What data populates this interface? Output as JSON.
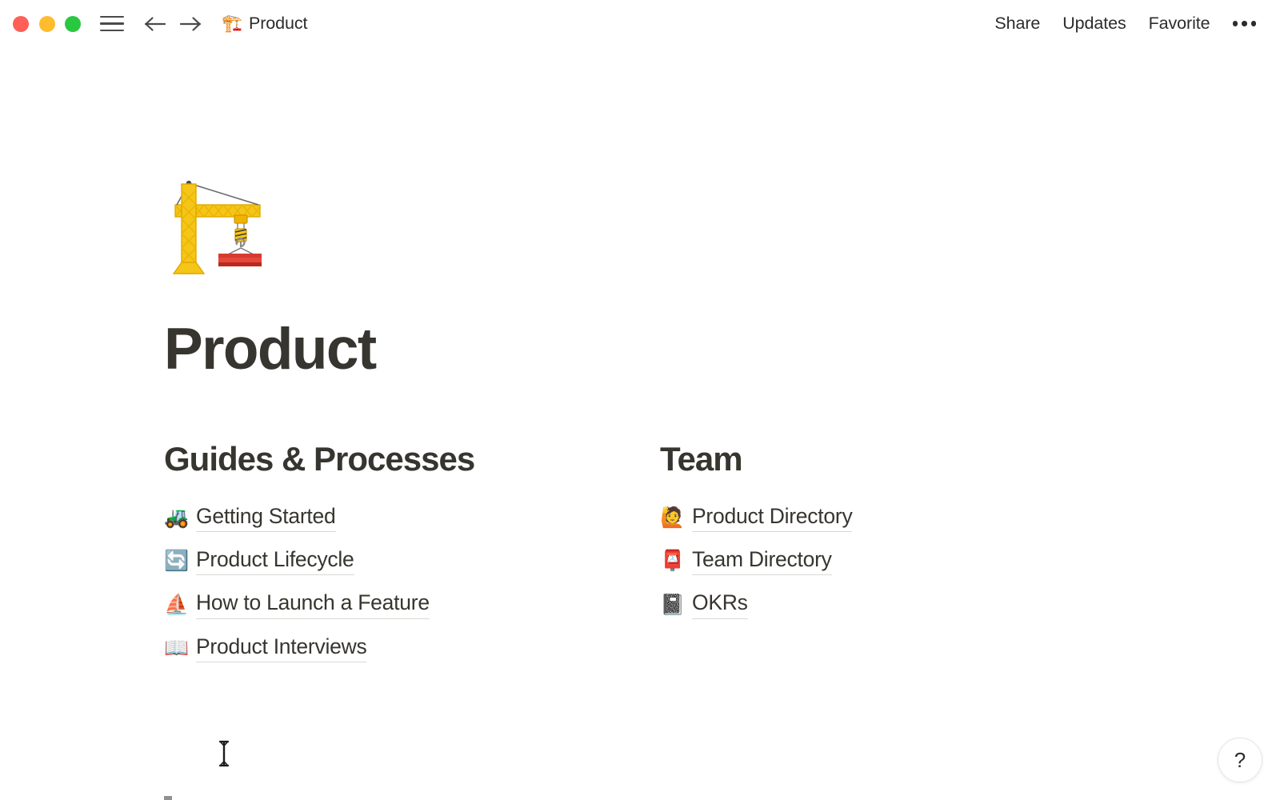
{
  "window": {
    "traffic_lights": [
      {
        "name": "close",
        "color": "#FF5F57"
      },
      {
        "name": "minimize",
        "color": "#FEBC2E"
      },
      {
        "name": "maximize",
        "color": "#28C840"
      }
    ]
  },
  "topbar": {
    "menu_icon": "hamburger-icon",
    "back_icon": "arrow-left-icon",
    "forward_icon": "arrow-right-icon",
    "breadcrumb": {
      "emoji": "🏗️",
      "emoji_name": "construction-crane-emoji",
      "title": "Product"
    },
    "actions": [
      {
        "label": "Share",
        "name": "share-button"
      },
      {
        "label": "Updates",
        "name": "updates-button"
      },
      {
        "label": "Favorite",
        "name": "favorite-button"
      }
    ],
    "more_label": "•••",
    "more_name": "more-options-button"
  },
  "page": {
    "icon_emoji": "🏗️",
    "icon_emoji_name": "construction-crane-emoji",
    "title": "Product"
  },
  "columns": [
    {
      "heading": "Guides & Processes",
      "name": "column-guides-processes",
      "links": [
        {
          "emoji": "🚜",
          "emoji_name": "tractor-emoji",
          "label": "Getting Started"
        },
        {
          "emoji": "🔄",
          "emoji_name": "counterclockwise-arrows-emoji",
          "label": "Product Lifecycle"
        },
        {
          "emoji": "⛵",
          "emoji_name": "sailboat-emoji",
          "label": "How to Launch a Feature"
        },
        {
          "emoji": "📖",
          "emoji_name": "open-book-emoji",
          "label": "Product Interviews"
        }
      ]
    },
    {
      "heading": "Team",
      "name": "column-team",
      "links": [
        {
          "emoji": "🙋",
          "emoji_name": "person-raising-hand-emoji",
          "label": "Product Directory"
        },
        {
          "emoji": "📮",
          "emoji_name": "postbox-emoji",
          "label": "Team Directory"
        },
        {
          "emoji": "📓",
          "emoji_name": "notebook-emoji",
          "label": "OKRs"
        }
      ]
    }
  ],
  "help": {
    "label": "?",
    "name": "help-button"
  },
  "colors": {
    "text": "#37352f",
    "topbar_text": "#2c2c2c",
    "link_underline": "#d8d8d6",
    "background": "#ffffff"
  }
}
